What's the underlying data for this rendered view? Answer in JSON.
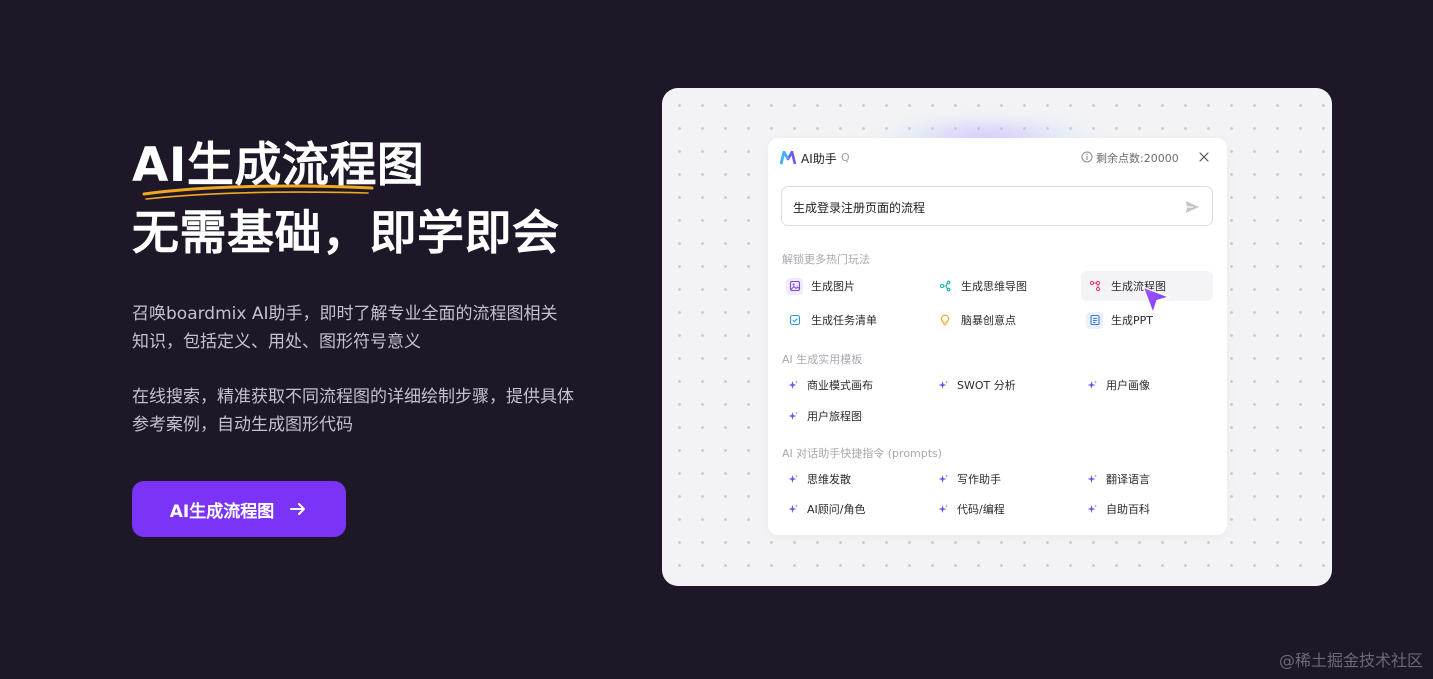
{
  "hero": {
    "title_line1": "AI生成流程图",
    "title_line2": "无需基础，即学即会",
    "desc1": "召唤boardmix AI助手，即时了解专业全面的流程图相关知识，包括定义、用处、图形符号意义",
    "desc2": "在线搜索，精准获取不同流程图的详细绘制步骤，提供具体参考案例，自动生成图形代码",
    "cta_label": "AI生成流程图",
    "cta_icon": "arrow-right-icon"
  },
  "assistant": {
    "title": "AI助手",
    "q": "Q",
    "points_label": "剩余点数:20000",
    "prompt_value": "生成登录注册页面的流程",
    "sections": {
      "hot": {
        "label": "解锁更多热门玩法",
        "items": [
          {
            "label": "生成图片",
            "icon": "image-icon",
            "color": "#7b4ae0"
          },
          {
            "label": "生成思维导图",
            "icon": "mindmap-icon",
            "color": "#18b6a8"
          },
          {
            "label": "生成流程图",
            "icon": "flowchart-icon",
            "color": "#e2407a"
          },
          {
            "label": "生成任务清单",
            "icon": "checklist-icon",
            "color": "#2aa0d8"
          },
          {
            "label": "脑暴创意点",
            "icon": "lightbulb-icon",
            "color": "#e5a81b"
          },
          {
            "label": "生成PPT",
            "icon": "ppt-icon",
            "color": "#3a7ce8"
          }
        ]
      },
      "templates": {
        "label": "AI 生成实用模板",
        "items": [
          "商业模式画布",
          "SWOT 分析",
          "用户画像",
          "用户旅程图"
        ]
      },
      "prompts": {
        "label": "AI 对话助手快捷指令 (prompts)",
        "items": [
          "思维发散",
          "写作助手",
          "翻译语言",
          "AI顾问/角色",
          "代码/编程",
          "自助百科"
        ]
      }
    }
  },
  "watermark": "@稀土掘金技术社区",
  "colors": {
    "background": "#1d1728",
    "accent": "#7a33f7",
    "underline": "#f0a81e"
  }
}
